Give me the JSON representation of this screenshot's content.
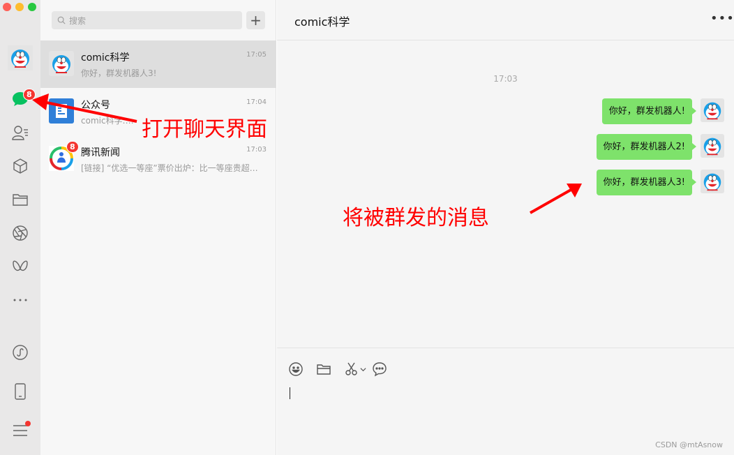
{
  "window": {
    "traffic_lights": {
      "close": "#fe5f57",
      "minimize": "#febc2e",
      "zoom": "#28c840"
    }
  },
  "rail": {
    "items": [
      {
        "name": "chats",
        "icon": "chat-bubble-icon",
        "badge": "8",
        "color": "#07c160"
      },
      {
        "name": "contacts",
        "icon": "contacts-icon"
      },
      {
        "name": "favorites",
        "icon": "cube-icon"
      },
      {
        "name": "files",
        "icon": "folder-icon"
      },
      {
        "name": "moments",
        "icon": "aperture-icon"
      },
      {
        "name": "channels",
        "icon": "butterfly-icon"
      },
      {
        "name": "more",
        "icon": "more-dots-icon"
      },
      {
        "name": "mini-programs",
        "icon": "mini-program-icon"
      },
      {
        "name": "phone",
        "icon": "phone-icon"
      },
      {
        "name": "settings",
        "icon": "menu-icon",
        "has_dot": true
      }
    ]
  },
  "search": {
    "placeholder": "搜索",
    "add_label": "+"
  },
  "conversations": [
    {
      "name": "comic科学",
      "time": "17:05",
      "preview": "你好，群发机器人3!",
      "active": true,
      "avatar": "doraemon-avatar"
    },
    {
      "name": "公众号",
      "time": "17:04",
      "preview": "comic科学:…",
      "avatar": "official-account-avatar",
      "color": "#2f7fd8"
    },
    {
      "name": "腾讯新闻",
      "time": "17:03",
      "preview": "[链接] “优选一等座”票价出炉：比一等座贵超…",
      "badge": "8",
      "avatar": "tencent-news-avatar"
    }
  ],
  "chat": {
    "title": "comic科学",
    "more_label": "•••",
    "time_divider": "17:03",
    "messages": [
      {
        "text": "你好，群发机器人!",
        "sender": "self"
      },
      {
        "text": "你好，群发机器人2!",
        "sender": "self"
      },
      {
        "text": "你好，群发机器人3!",
        "sender": "self"
      }
    ],
    "bubble_color": "#7ee26b",
    "toolbar": [
      "emoji-icon",
      "folder-icon",
      "scissors-icon",
      "chat-history-icon"
    ]
  },
  "watermark": "CSDN @mtAsnow",
  "annotations": {
    "open_chat": "打开聊天界面",
    "broadcast_msgs": "将被群发的消息",
    "color": "#ff0000"
  }
}
